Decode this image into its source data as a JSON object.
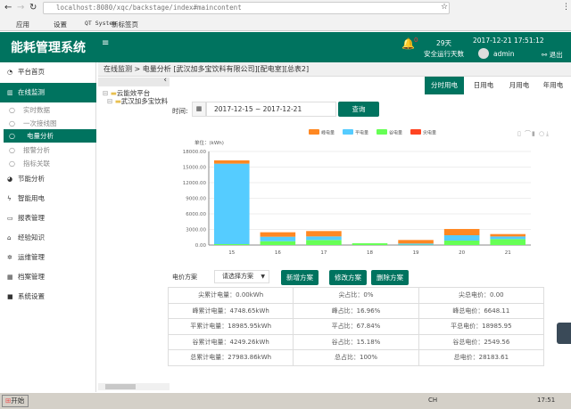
{
  "browser": {
    "url": "localhost:8080/xqc/backstage/index#maincontent",
    "bookmarks": [
      "应用",
      "设置",
      "QT System",
      "新标签页"
    ]
  },
  "header": {
    "title": "能耗管理系统",
    "alarm_count": "0",
    "days": "29天",
    "days_label": "安全运行天数",
    "datetime": "2017-12-21 17:51:12",
    "user": "admin",
    "logout": "退出"
  },
  "sidebar": {
    "items": [
      {
        "label": "平台首页",
        "icon": "dashboard-icon"
      },
      {
        "label": "在线监测",
        "icon": "bar-chart-icon",
        "active": true
      },
      {
        "label": "节能分析",
        "icon": "pie-chart-icon"
      },
      {
        "label": "智能用电",
        "icon": "bolt-icon"
      },
      {
        "label": "报表管理",
        "icon": "monitor-icon"
      },
      {
        "label": "经验知识",
        "icon": "home-icon"
      },
      {
        "label": "运维管理",
        "icon": "gear-icon"
      },
      {
        "label": "档案管理",
        "icon": "table-icon"
      },
      {
        "label": "系统设置",
        "icon": "folder-icon"
      }
    ],
    "subitems": [
      {
        "label": "实时数据"
      },
      {
        "label": "一次接线图"
      },
      {
        "label": "电量分析",
        "active": true
      },
      {
        "label": "报警分析"
      },
      {
        "label": "指标关联"
      }
    ]
  },
  "breadcrumb": "在线监测 > 电量分析 [武汉加多宝饮料有限公司][配电室][总表2]",
  "tree": [
    "云能效平台",
    "武汉加多宝饮料"
  ],
  "tabs": [
    "分时用电",
    "日用电",
    "月用电",
    "年用电"
  ],
  "query": {
    "time_label": "时间:",
    "range": "2017-12-15 ~ 2017-12-21",
    "button": "查询"
  },
  "chart_data": {
    "type": "bar",
    "stacked": true,
    "ylabel": "单位：(kWh)",
    "ylim": [
      0,
      18000
    ],
    "yticks": [
      "0.00",
      "3000.00",
      "6000.00",
      "9000.00",
      "12000.00",
      "15000.00",
      "18000.00"
    ],
    "categories": [
      "15",
      "16",
      "17",
      "18",
      "19",
      "20",
      "21"
    ],
    "legend_position": "top",
    "series": [
      {
        "name": "谷电量",
        "color": "#66ff55",
        "values": [
          170,
          740,
          970,
          340,
          60,
          860,
          1140
        ]
      },
      {
        "name": "平电量",
        "color": "#55ccff",
        "values": [
          15490,
          860,
          690,
          0,
          230,
          1030,
          510
        ]
      },
      {
        "name": "峰电量",
        "color": "#ff8822",
        "values": [
          630,
          860,
          1030,
          0,
          680,
          1200,
          460
        ]
      },
      {
        "name": "尖电量",
        "color": "#ff4422",
        "values": [
          0,
          0,
          0,
          0,
          0,
          0,
          0
        ]
      }
    ],
    "grid": true
  },
  "scheme": {
    "label": "电价方案",
    "select": "请选择方案",
    "add": "新增方案",
    "edit": "修改方案",
    "delete": "删除方案"
  },
  "stats": [
    [
      "尖累计电量：0.00kWh",
      "尖占比：0%",
      "尖总电价：0.00"
    ],
    [
      "峰累计电量：4748.65kWh",
      "峰占比：16.96%",
      "峰总电价：6648.11"
    ],
    [
      "平累计电量：18985.95kWh",
      "平占比：67.84%",
      "平总电价：18985.95"
    ],
    [
      "谷累计电量：4249.26kWh",
      "谷占比：15.18%",
      "谷总电价：2549.56"
    ],
    [
      "总累计电量：27983.86kWh",
      "总占比：100%",
      "总电价：28183.61"
    ]
  ],
  "taskbar": {
    "start": "开始",
    "lang": "CH",
    "clock": "17:51"
  }
}
